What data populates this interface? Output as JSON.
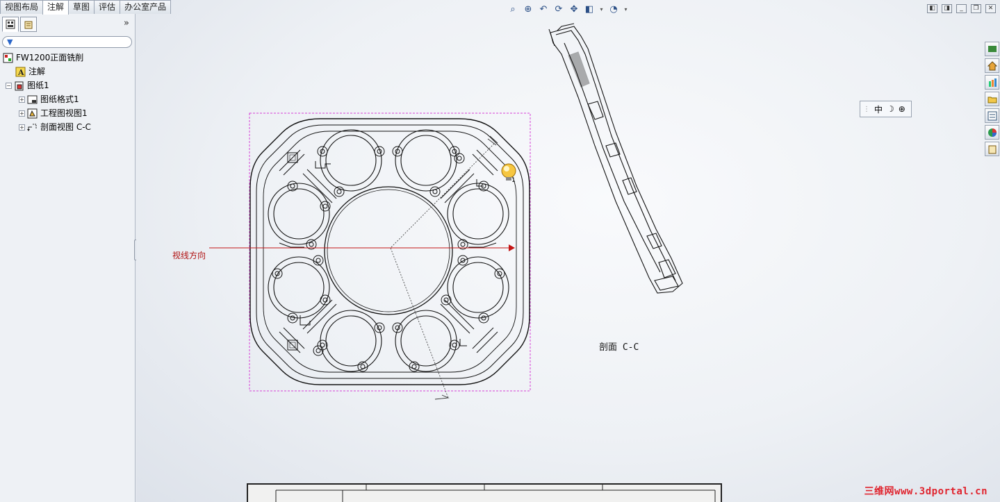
{
  "command_manager": {
    "tabs": [
      {
        "label": "视图布局"
      },
      {
        "label": "注解"
      },
      {
        "label": "草图"
      },
      {
        "label": "评估"
      },
      {
        "label": "办公室产品"
      }
    ],
    "active_tab": "注解"
  },
  "feature_tree": {
    "expand_glyph": "»",
    "filter_glyph": "▼",
    "root": "FW1200正面铣削",
    "items": [
      {
        "label": "注解",
        "icon": "annotation-icon"
      },
      {
        "label": "图纸1",
        "icon": "sheet-icon"
      },
      {
        "label": "图纸格式1",
        "icon": "sheet-format-icon"
      },
      {
        "label": "工程图视图1",
        "icon": "drawing-view-icon"
      },
      {
        "label": "剖面视图 C-C",
        "icon": "section-view-icon"
      }
    ]
  },
  "view_toolbar": {
    "icons": [
      "zoom-to-fit-icon",
      "zoom-area-icon",
      "previous-view-icon",
      "rotate-icon",
      "pan-icon",
      "display-style-icon",
      "hide-show-icon"
    ]
  },
  "float_toolbar": {
    "label": "中"
  },
  "drawing": {
    "view_direction_label": "视线方向",
    "section_label": "剖面 C-C",
    "notes_badge": "1"
  },
  "watermark": "三维网www.3dportal.cn",
  "colors": {
    "selection_box": "#d63fd6",
    "section_arrow": "#c41515",
    "watermark": "#e0242e"
  }
}
